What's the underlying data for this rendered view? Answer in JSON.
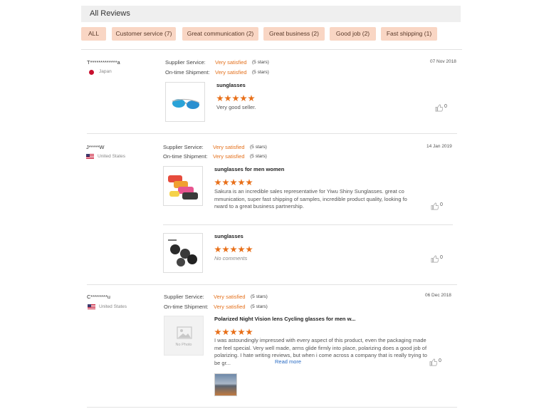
{
  "header": {
    "title": "All Reviews"
  },
  "filters": [
    {
      "label": "ALL"
    },
    {
      "label": "Customer service (7)"
    },
    {
      "label": "Great communication (2)"
    },
    {
      "label": "Great business (2)"
    },
    {
      "label": "Good job (2)"
    },
    {
      "label": "Fast shipping (1)"
    }
  ],
  "labels": {
    "supplier_service": "Supplier Service:",
    "ontime_shipment": "On-time Shipment:",
    "read_more": "Read more",
    "no_photo": "No Photo"
  },
  "reviews": [
    {
      "user": "T*************a",
      "country": "Japan",
      "supplier_value": "Very satisfied",
      "supplier_stars": "(5 stars)",
      "shipment_value": "Very satisfied",
      "shipment_stars": "(5 stars)",
      "date": "07 Nov 2018",
      "items": [
        {
          "title": "sunglasses",
          "rating": 5,
          "text": "Very good seller.",
          "likes": "0"
        }
      ]
    },
    {
      "user": "J*****W",
      "country": "United States",
      "supplier_value": "Very satisfied",
      "supplier_stars": "(5 stars)",
      "shipment_value": "Very satisfied",
      "shipment_stars": "(5 stars)",
      "date": "14 Jan 2019",
      "items": [
        {
          "title": "sunglasses for men women",
          "rating": 5,
          "text": "Sakura is an incredible sales representative for Yiwu Shiny Sunglasses. great communication, super fast shipping of samples, incredible product quality, looking forward to a great business partnership.",
          "likes": "0"
        },
        {
          "title": "sunglasses",
          "rating": 5,
          "text": "No comments",
          "likes": "0"
        }
      ]
    },
    {
      "user": "C********u",
      "country": "United States",
      "supplier_value": "Very satisfied",
      "supplier_stars": "(5 stars)",
      "shipment_value": "Very satisfied",
      "shipment_stars": "(5 stars)",
      "date": "06 Dec 2018",
      "items": [
        {
          "title": "Polarized Night Vision lens Cycling glasses for men w...",
          "rating": 5,
          "text": "I was astoundingly impressed with every aspect of this product, even the packaging made me feel special. Very well made, arms glide firmly into place, polarizing does a good job of polarizing. I hate writing reviews, but when i come across a company that is really trying to be gr...",
          "likes": "0"
        }
      ]
    }
  ],
  "colors": {
    "accent": "#e4711d",
    "chip_bg": "#f9d6c4",
    "link": "#2a6cc4"
  }
}
